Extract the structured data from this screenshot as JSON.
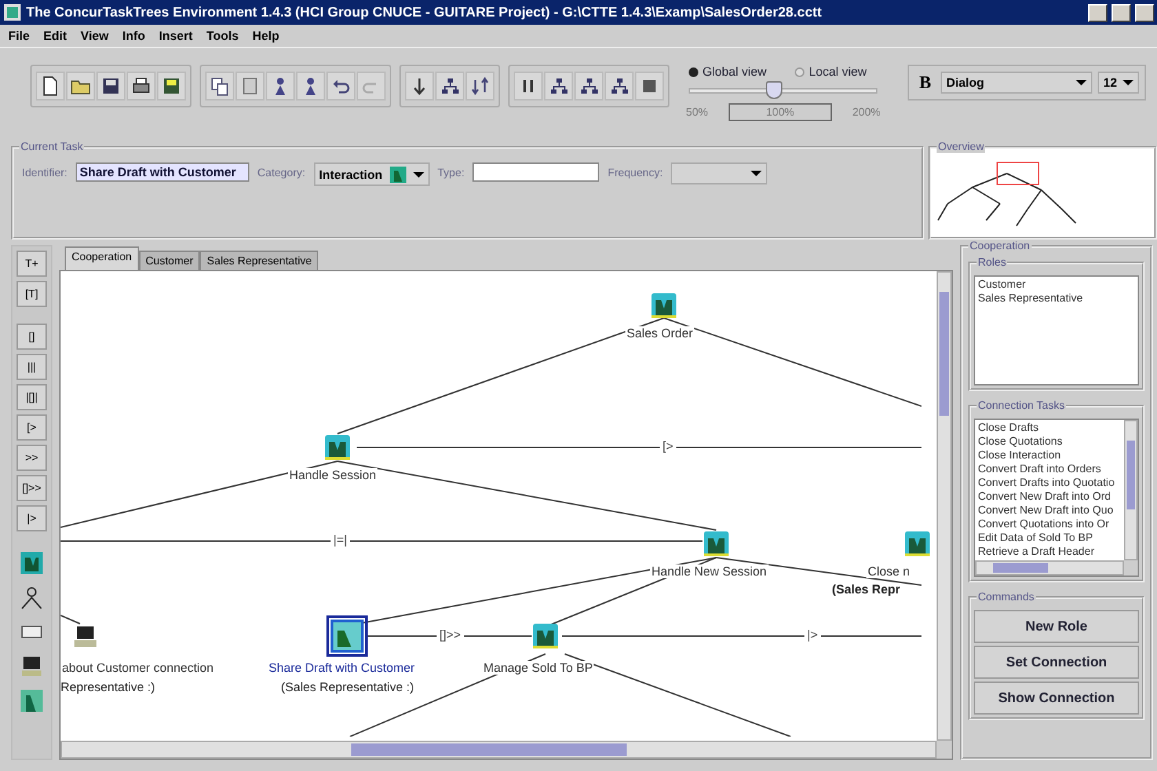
{
  "window": {
    "title": "The ConcurTaskTrees Environment 1.4.3 (HCI Group CNUCE - GUITARE Project) - G:\\CTTE 1.4.3\\Examp\\SalesOrder28.cctt"
  },
  "menu": [
    "File",
    "Edit",
    "View",
    "Info",
    "Insert",
    "Tools",
    "Help"
  ],
  "view_mode": [
    {
      "label": "Global view",
      "selected": true
    },
    {
      "label": "Local view",
      "selected": false
    }
  ],
  "zoom": {
    "level": 0.45,
    "min_label": "50%",
    "value": "100%",
    "max_label": "200%"
  },
  "font": {
    "bold_label": "B",
    "family": "Dialog",
    "size": "12"
  },
  "current_task": {
    "title": "Current Task",
    "identifier_label": "Identifier:",
    "identifier": "Share Draft with Customer",
    "category_label": "Category:",
    "category": "Interaction",
    "type_label": "Type:",
    "frequency_label": "Frequency:"
  },
  "overview": {
    "title": "Overview"
  },
  "left_tools": [
    "T+",
    "[T]",
    "[]",
    "|||",
    "|[]|",
    "[>",
    ">>",
    "[]>>",
    "|>"
  ],
  "tabs": [
    {
      "label": "Cooperation",
      "selected": true
    },
    {
      "label": "Customer",
      "selected": false
    },
    {
      "label": "Sales Representative",
      "selected": false
    }
  ],
  "canvas": {
    "nodes": [
      {
        "label": "Sales Order",
        "kind": "abstract",
        "selected": false
      },
      {
        "label": "Handle Session",
        "kind": "abstract",
        "selected": false
      },
      {
        "label": "Handle New Session",
        "kind": "abstract",
        "selected": false
      },
      {
        "label": "Close n",
        "sublabel": "(Sales Repr",
        "kind": "abstract",
        "selected": false
      },
      {
        "label": "about Customer connection",
        "sublabel": "Representative :)",
        "kind": "application",
        "selected": false
      },
      {
        "label": "Share Draft with Customer",
        "sublabel": "(Sales Representative :)",
        "kind": "interaction",
        "selected": true
      },
      {
        "label": "Manage Sold To BP",
        "kind": "abstract",
        "selected": false
      }
    ],
    "operators": [
      "[>",
      "|=|",
      "[]>>",
      "|>"
    ]
  },
  "cooperation": {
    "title": "Cooperation",
    "roles_title": "Roles",
    "roles": [
      "Customer",
      "Sales Representative"
    ],
    "connections_title": "Connection Tasks",
    "connections": [
      "Close Drafts",
      "Close Quotations",
      "Close Interaction",
      "Convert Draft into Orders",
      "Convert Drafts into Quotatio",
      "Convert New Draft into Ord",
      "Convert New Draft into Quo",
      "Convert Quotations into Or",
      "Edit Data of Sold To BP",
      "Retrieve a Draft Header"
    ],
    "commands_title": "Commands",
    "buttons": [
      "New Role",
      "Set Connection",
      "Show Connection"
    ]
  }
}
